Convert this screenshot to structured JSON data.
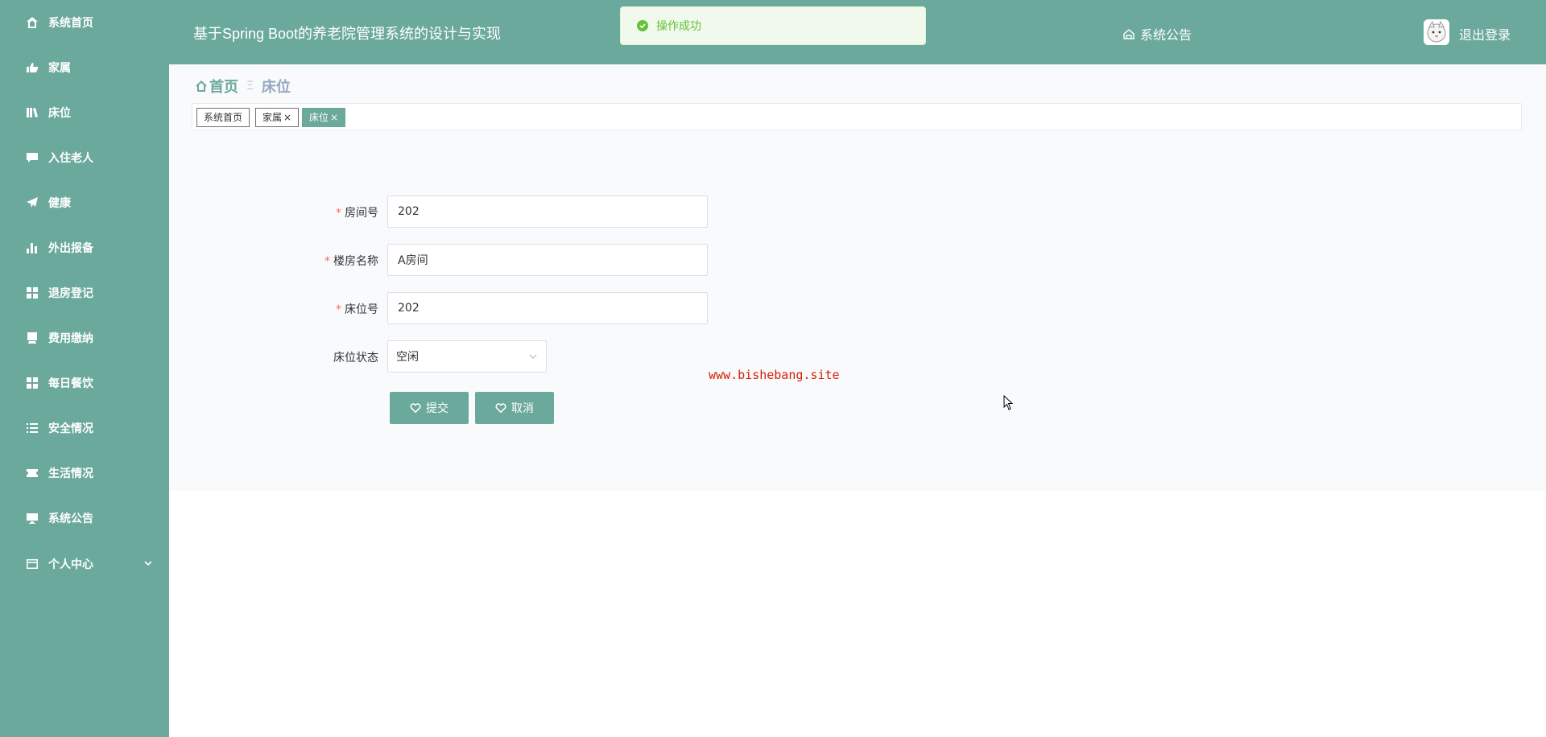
{
  "header": {
    "title": "基于Spring Boot的养老院管理系统的设计与实现",
    "notice_label": "系统公告",
    "logout_label": "退出登录"
  },
  "toast": {
    "message": "操作成功",
    "type": "success"
  },
  "sidebar": {
    "items": [
      {
        "label": "系统首页",
        "icon": "home-icon"
      },
      {
        "label": "家属",
        "icon": "thumbs-up-icon"
      },
      {
        "label": "床位",
        "icon": "bed-icon"
      },
      {
        "label": "入住老人",
        "icon": "chat-icon"
      },
      {
        "label": "健康",
        "icon": "paper-plane-icon"
      },
      {
        "label": "外出报备",
        "icon": "bar-chart-icon"
      },
      {
        "label": "退房登记",
        "icon": "grid-icon"
      },
      {
        "label": "费用缴纳",
        "icon": "card-icon"
      },
      {
        "label": "每日餐饮",
        "icon": "grid-icon"
      },
      {
        "label": "安全情况",
        "icon": "list-icon"
      },
      {
        "label": "生活情况",
        "icon": "ticket-icon"
      },
      {
        "label": "系统公告",
        "icon": "monitor-icon"
      },
      {
        "label": "个人中心",
        "icon": "id-card-icon"
      }
    ]
  },
  "breadcrumb": {
    "home": "首页",
    "current": "床位"
  },
  "tags": [
    {
      "label": "系统首页",
      "closable": false
    },
    {
      "label": "家属",
      "closable": true
    },
    {
      "label": "床位",
      "closable": true,
      "active": true
    }
  ],
  "close_glyph": "×",
  "form": {
    "room_no": {
      "label": "房间号",
      "value": "202",
      "required": true
    },
    "building_name": {
      "label": "楼房名称",
      "value": "A房间",
      "required": true
    },
    "bed_no": {
      "label": "床位号",
      "value": "202",
      "required": true
    },
    "bed_status": {
      "label": "床位状态",
      "value": "空闲",
      "required": false
    },
    "required_mark": "*",
    "submit_label": "提交",
    "cancel_label": "取消"
  },
  "watermark": "www.bishebang.site",
  "colors": {
    "primary": "#6ba99c",
    "success": "#67c23a",
    "required": "#f56c6c",
    "watermark": "#d81e06"
  }
}
